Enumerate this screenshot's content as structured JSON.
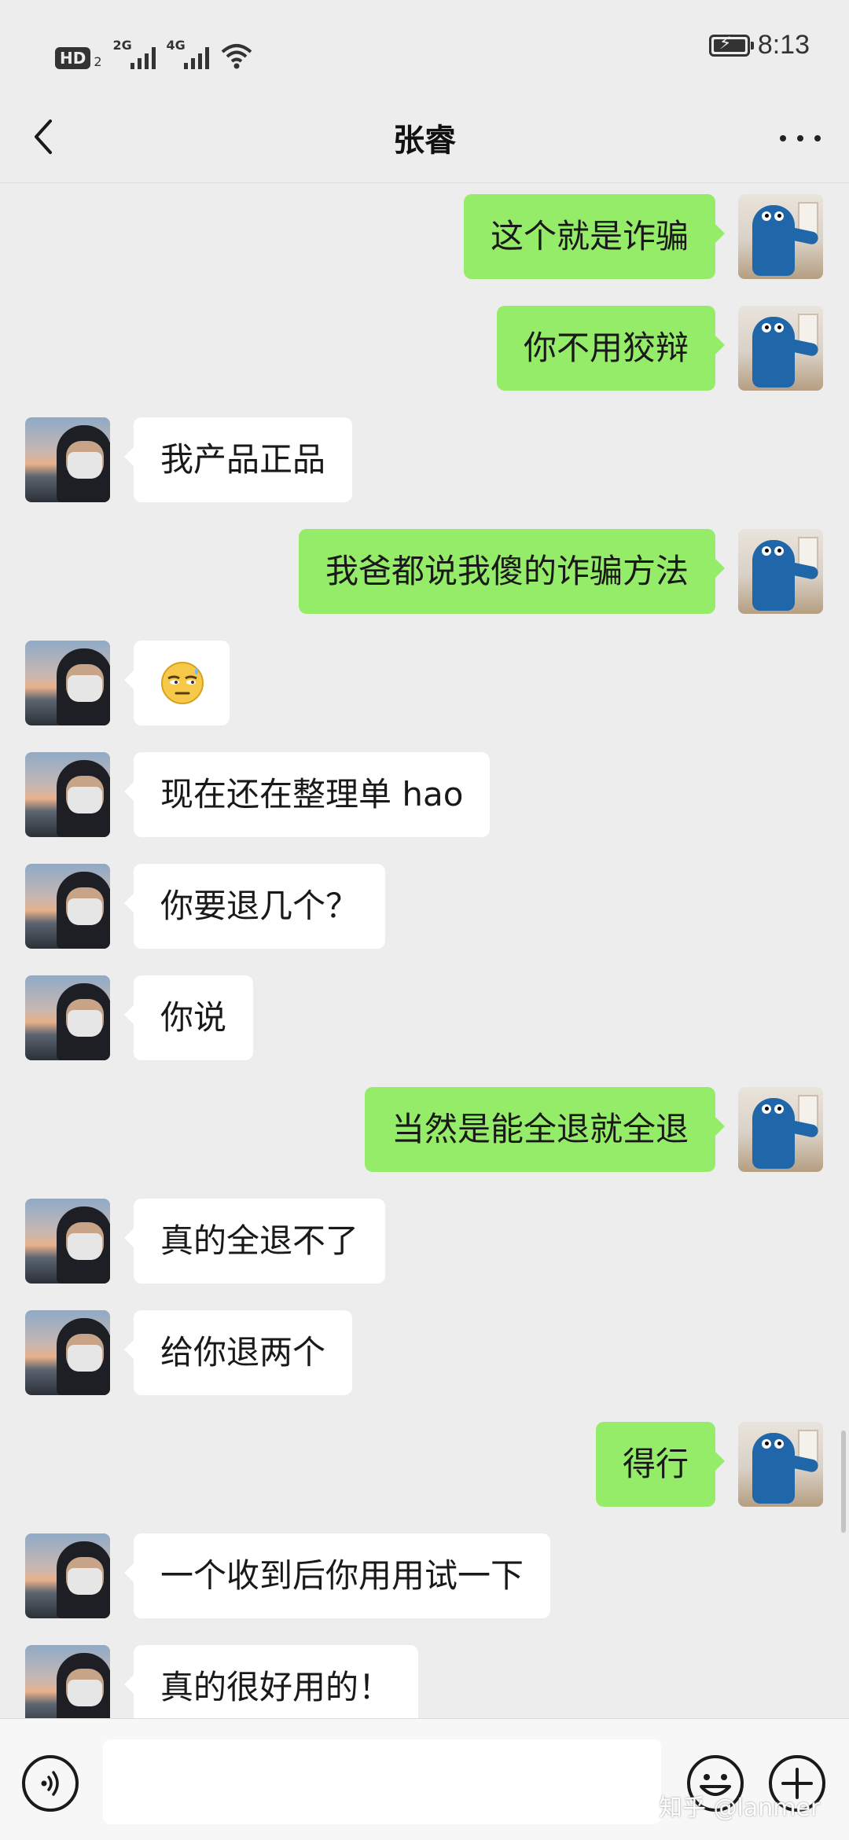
{
  "status_bar": {
    "hd_label": "HD",
    "hd_sub": "2",
    "signal_1": "2G",
    "signal_2": "4G",
    "time": "8:13",
    "battery_level": 1.0
  },
  "header": {
    "title": "张睿"
  },
  "messages": [
    {
      "side": "right",
      "sender": "me",
      "text": "这个就是诈骗"
    },
    {
      "side": "right",
      "sender": "me",
      "text": "你不用狡辩"
    },
    {
      "side": "left",
      "sender": "contact",
      "text": "我产品正品"
    },
    {
      "side": "right",
      "sender": "me",
      "text": "我爸都说我傻的诈骗方法"
    },
    {
      "side": "left",
      "sender": "contact",
      "emoji": "sweat-smirk-emoji",
      "text": ""
    },
    {
      "side": "left",
      "sender": "contact",
      "text": "现在还在整理单 hao"
    },
    {
      "side": "left",
      "sender": "contact",
      "text": "你要退几个？"
    },
    {
      "side": "left",
      "sender": "contact",
      "text": "你说"
    },
    {
      "side": "right",
      "sender": "me",
      "text": "当然是能全退就全退"
    },
    {
      "side": "left",
      "sender": "contact",
      "text": "真的全退不了"
    },
    {
      "side": "left",
      "sender": "contact",
      "text": "给你退两个"
    },
    {
      "side": "right",
      "sender": "me",
      "text": "得行"
    },
    {
      "side": "left",
      "sender": "contact",
      "text": "一个收到后你用用试一下"
    },
    {
      "side": "left",
      "sender": "contact",
      "text": "真的很好用的！"
    }
  ],
  "input_bar": {
    "text_value": "",
    "watermark": "知乎 @lanmer"
  },
  "colors": {
    "background": "#ededed",
    "my_bubble": "#95ec69",
    "their_bubble": "#ffffff"
  }
}
